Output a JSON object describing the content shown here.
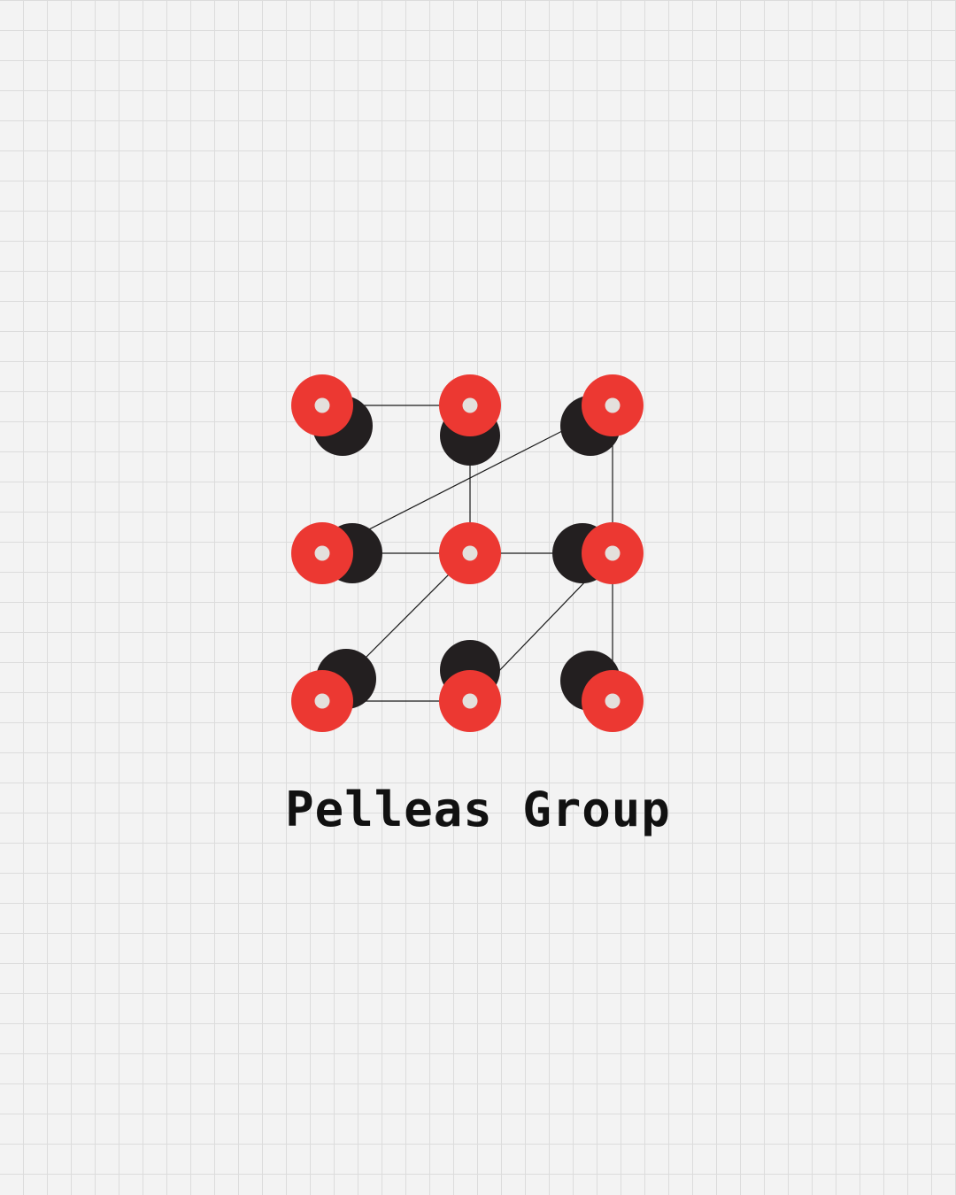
{
  "brand": {
    "name": "Pelleas Group"
  },
  "colors": {
    "background": "#f3f3f3",
    "grid": "#dcdcdc",
    "accent": "#ec3832",
    "shadow": "#231f20",
    "core": "#e4e0dc",
    "line": "#1a1a1a",
    "text": "#111111"
  },
  "logo": {
    "description_icon": "node-grid-logo-icon"
  }
}
